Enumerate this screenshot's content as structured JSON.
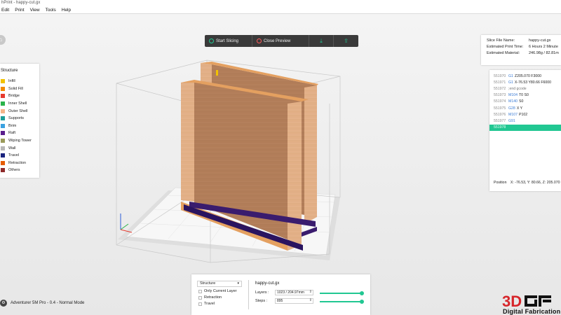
{
  "window": {
    "title": "hPrint - happy-cut.gx"
  },
  "menu": [
    "Edit",
    "Print",
    "View",
    "Tools",
    "Help"
  ],
  "toolbar": {
    "start_slicing": "Start Slicing",
    "close_preview": "Close Preview",
    "save_icon": "download-icon",
    "print_icon": "send-to-printer-icon"
  },
  "structure": {
    "title": "Structure",
    "items": [
      {
        "label": "Infill",
        "color": "#f2c200"
      },
      {
        "label": "Solid Fill",
        "color": "#f28a00"
      },
      {
        "label": "Bridge",
        "color": "#e63a2e"
      },
      {
        "label": "Inner Shell",
        "color": "#2ab34a"
      },
      {
        "label": "Outer Shell",
        "color": "#f4b58a"
      },
      {
        "label": "Supports",
        "color": "#1d9e98"
      },
      {
        "label": "Brim",
        "color": "#3aa1e0"
      },
      {
        "label": "Raft",
        "color": "#5a1e8c"
      },
      {
        "label": "Wiping Tower",
        "color": "#9a9a5a"
      },
      {
        "label": "Wall",
        "color": "#b7b7b7"
      },
      {
        "label": "Travel",
        "color": "#1a237e"
      },
      {
        "label": "Retraction",
        "color": "#e65c00"
      },
      {
        "label": "Others",
        "color": "#8e2a2a"
      }
    ]
  },
  "slice_info": {
    "file_name_label": "Slice File Name:",
    "file_name": "happy-cut.gx",
    "print_time_label": "Estimated Print Time:",
    "print_time": "6 Hours 2 Minute",
    "material_label": "Estimated Material:",
    "material": "246.98g / 82.81m"
  },
  "gcode": {
    "lines": [
      {
        "num": "551970",
        "cmd": "G1",
        "args": "Z205.070 F3000"
      },
      {
        "num": "551971",
        "cmd": "G1",
        "args": "X-76.53 Y80.66 F6000"
      },
      {
        "num": "551972",
        "cmd": "",
        "comment": ";end gcode"
      },
      {
        "num": "551973",
        "cmd": "M104",
        "args": "T0 S0"
      },
      {
        "num": "551974",
        "cmd": "M140",
        "args": "S0"
      },
      {
        "num": "551975",
        "cmd": "G28",
        "args": "X Y"
      },
      {
        "num": "551976",
        "cmd": "M107",
        "args": "P102"
      },
      {
        "num": "551977",
        "cmd": "G91",
        "args": ""
      },
      {
        "num": "551978",
        "cmd": "",
        "args": "",
        "active": true
      }
    ],
    "position_label": "Position",
    "position_value": "X: -76.53, Y: 80.66, Z: 205.070"
  },
  "preview_controls": {
    "mode": "Structure",
    "only_current_layer": "Only Current Layer",
    "retraction": "Retraction",
    "travel": "Travel",
    "file_name": "happy-cut.gx",
    "layers_label": "Layers :",
    "layers_value": "1023 / 204.97mm",
    "steps_label": "Steps :",
    "steps_value": "895",
    "layers_fraction": 1.0,
    "steps_fraction": 1.0
  },
  "machine": {
    "label": "Adventurer 5M Pro - 0.4 - Normal Mode"
  },
  "brand": {
    "logo": "3DG",
    "tagline": "Digital Fabrication"
  }
}
